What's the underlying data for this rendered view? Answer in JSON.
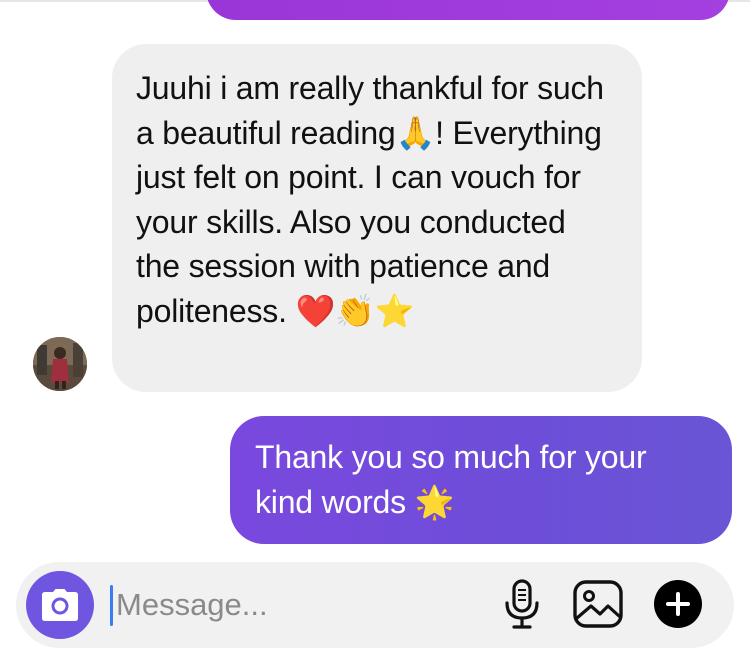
{
  "conversation": {
    "incoming_message": {
      "text": "Juuhi i am really thankful for such a beautiful reading🙏! Everything just felt on point. I can vouch for your skills. Also you conducted the session with patience and politeness. ❤️👏⭐"
    },
    "outgoing_message": {
      "text": "Thank you so much for your kind words 🌟"
    }
  },
  "composer": {
    "placeholder": "Message...",
    "value": "",
    "icons": [
      "camera-icon",
      "microphone-icon",
      "gallery-icon",
      "add-icon"
    ]
  },
  "colors": {
    "accent_purple": "#6f55e0",
    "outgoing_bubble": "#7a48de",
    "incoming_bubble": "#efefef",
    "previous_bubble": "#9a35d8",
    "caret": "#3a7cf3"
  }
}
